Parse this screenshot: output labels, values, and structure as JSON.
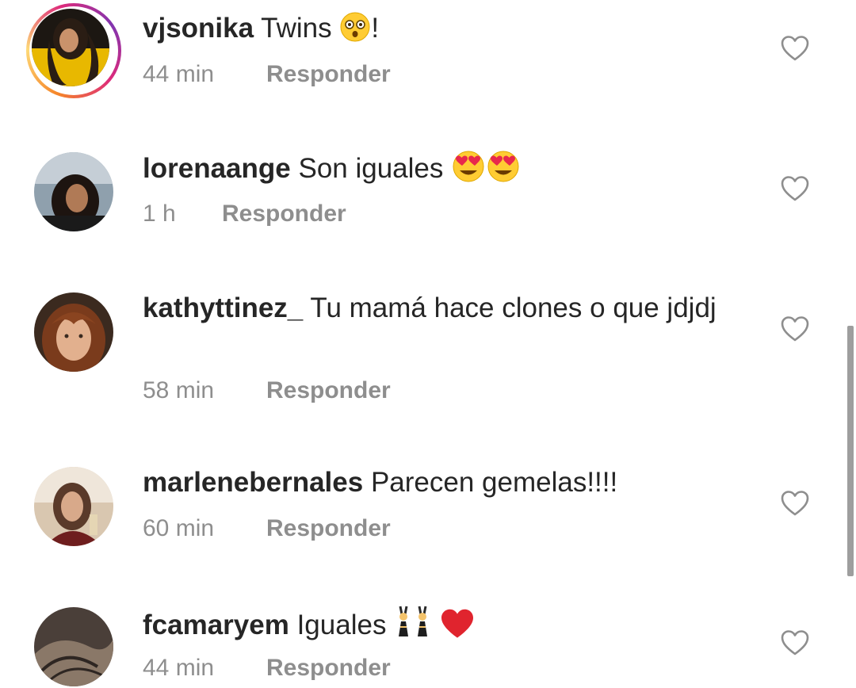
{
  "icons": {
    "like": "heart-outline-icon",
    "emoji_astonished": "astonished-face-icon",
    "emoji_heart_eyes": "heart-eyes-face-icon",
    "emoji_bunny": "people-with-bunny-ears-icon",
    "emoji_heart": "red-heart-icon"
  },
  "colors": {
    "text": "#262626",
    "secondary": "#8e8e8e",
    "story_ring_start": "#f58529",
    "story_ring_end": "#dd2a7b",
    "heart_red": "#e0242e"
  },
  "comments": [
    {
      "username": "vjsonika",
      "text": "Twins",
      "suffix": "!",
      "time": "44 min",
      "reply": "Responder"
    },
    {
      "username": "lorenaange",
      "text": "Son iguales",
      "suffix": "",
      "time": "1 h",
      "reply": "Responder"
    },
    {
      "username": "kathyttinez_",
      "text": "Tu mamá hace clones o que jdjdj",
      "suffix": "",
      "time": "58 min",
      "reply": "Responder"
    },
    {
      "username": "marlenebernales",
      "text": "Parecen gemelas!!!!",
      "suffix": "",
      "time": "60 min",
      "reply": "Responder"
    },
    {
      "username": "fcamaryem",
      "text": "Iguales",
      "suffix": "",
      "time": "44 min",
      "reply": "Responder"
    }
  ]
}
